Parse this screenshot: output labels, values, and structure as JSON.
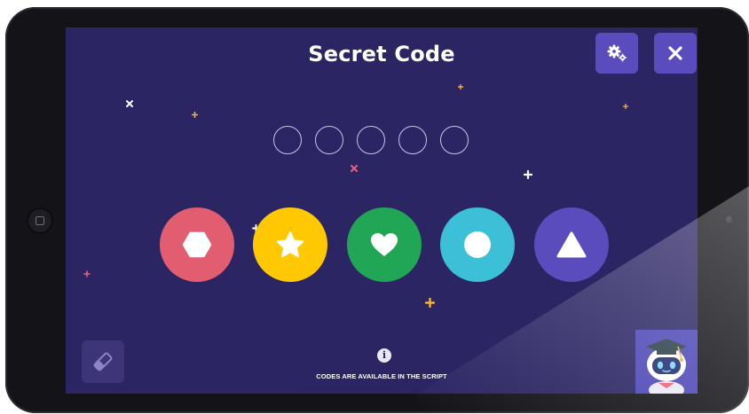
{
  "app": {
    "title": "Secret Code",
    "hint_text": "CODES ARE AVAILABLE IN THE SCRIPT",
    "info_icon_glyph": "i"
  },
  "toolbar": {
    "settings_icon": "gears-icon",
    "close_icon": "close-icon"
  },
  "code_slots": {
    "count": 5,
    "filled": 0
  },
  "shape_buttons": [
    {
      "name": "hexagon",
      "icon": "hexagon-icon",
      "color": "#e25d6f"
    },
    {
      "name": "star",
      "icon": "star-icon",
      "color": "#ffc800"
    },
    {
      "name": "heart",
      "icon": "heart-icon",
      "color": "#21a656"
    },
    {
      "name": "circle",
      "icon": "circle-icon",
      "color": "#3cc0d8"
    },
    {
      "name": "triangle",
      "icon": "triangle-icon",
      "color": "#5b4cbd"
    }
  ],
  "bottom": {
    "eraser_icon": "eraser-icon",
    "mascot": "robot-graduate-mascot"
  },
  "colors": {
    "background": "#2b2563",
    "accent_button": "#5b4cbd",
    "sparkle_white": "#ffffff",
    "sparkle_yellow": "#f6b431",
    "sparkle_pink": "#ef5f7b"
  }
}
